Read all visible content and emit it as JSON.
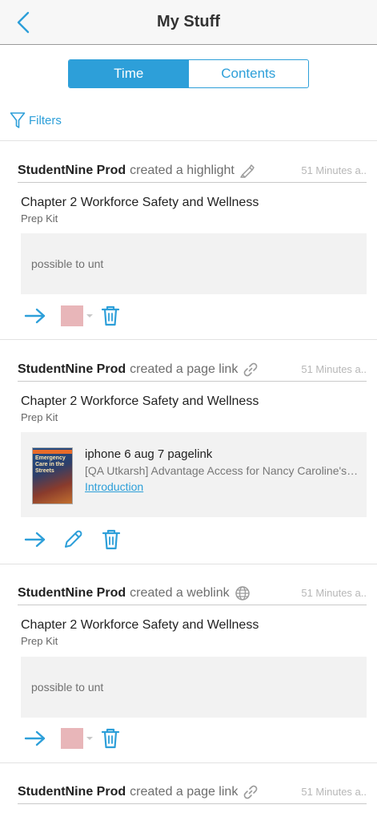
{
  "header": {
    "title": "My Stuff"
  },
  "segmented": {
    "time_label": "Time",
    "contents_label": "Contents",
    "active": "time"
  },
  "filters": {
    "label": "Filters"
  },
  "colors": {
    "accent": "#2d9fd9",
    "highlight_swatch": "#e8b6b9"
  },
  "cards": [
    {
      "author": "StudentNine Prod",
      "action": "created a highlight",
      "action_icon": "highlighter-icon",
      "time": "51 Minutes a..",
      "chapter": "Chapter 2 Workforce Safety and Wellness",
      "book": "Prep Kit",
      "note": "possible to unt"
    },
    {
      "author": "StudentNine Prod",
      "action": "created a page link",
      "action_icon": "link-icon",
      "time": "51 Minutes a..",
      "chapter": "Chapter 2 Workforce Safety and Wellness",
      "book": "Prep Kit",
      "link": {
        "cover_title": "Emergency Care in the Streets",
        "title": "iphone 6 aug 7 pagelink",
        "subtitle": "[QA Utkarsh] Advantage Access for Nancy Caroline's Emergency Care in the Streets",
        "anchor": "Introduction"
      }
    },
    {
      "author": "StudentNine Prod",
      "action": "created a weblink",
      "action_icon": "globe-icon",
      "time": "51 Minutes a..",
      "chapter": "Chapter 2 Workforce Safety and Wellness",
      "book": "Prep Kit",
      "note": "possible to unt"
    },
    {
      "author": "StudentNine Prod",
      "action": "created a page link",
      "action_icon": "link-icon",
      "time": "51 Minutes a.."
    }
  ]
}
